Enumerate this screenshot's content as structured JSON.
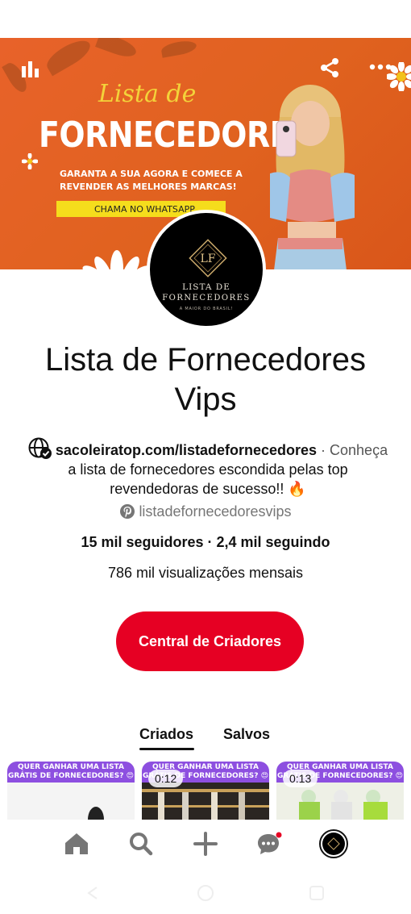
{
  "banner": {
    "script_title": "Lista de",
    "big_title": "FORNECEDORES",
    "sub_line_1": "GARANTA A SUA AGORA E COMECE A",
    "sub_line_2": "REVENDER AS MELHORES MARCAS!",
    "whatsapp_cta": "CHAMA NO WHATSAPP",
    "icons": [
      "stats-icon",
      "share-icon",
      "more-icon"
    ]
  },
  "avatar": {
    "line1": "LISTA DE",
    "line2": "FORNECEDORES",
    "line3": "A MAIOR DO BRASIL!"
  },
  "profile": {
    "name_line1": "Lista de Fornecedores",
    "name_line2": "Vips",
    "website": "sacoleiratop.com/listadefornecedores",
    "bio_part1": " · Conheça",
    "bio_line2": "a lista de fornecedores escondida pelas top",
    "bio_line3": "revendedoras de sucesso!! 🔥",
    "handle": "listadefornecedoresvips",
    "stats": "15 mil seguidores · 2,4 mil seguindo",
    "views": "786 mil visualizações mensais",
    "cta_label": "Central de Criadores"
  },
  "tabs": [
    {
      "label": "Criados",
      "active": true
    },
    {
      "label": "Salvos",
      "active": false
    }
  ],
  "pins": [
    {
      "header": "QUER GANHAR UMA LISTA GRÁTIS DE FORNECEDORES? 😍",
      "duration": ""
    },
    {
      "header": "QUER GANHAR UMA LISTA GRÁTIS DE FORNECEDORES? 😍",
      "duration": "0:12"
    },
    {
      "header": "QUER GANHAR UMA LISTA GRÁTIS DE FORNECEDORES? 😍",
      "duration": "0:13"
    }
  ],
  "navbar": {
    "items": [
      "home-icon",
      "search-icon",
      "create-icon",
      "messages-icon",
      "profile-avatar"
    ],
    "notification_color": "#e60023"
  },
  "colors": {
    "accent": "#e60023",
    "banner_orange": "#e0621f",
    "pin_header_purple": "#8d4fe0"
  }
}
